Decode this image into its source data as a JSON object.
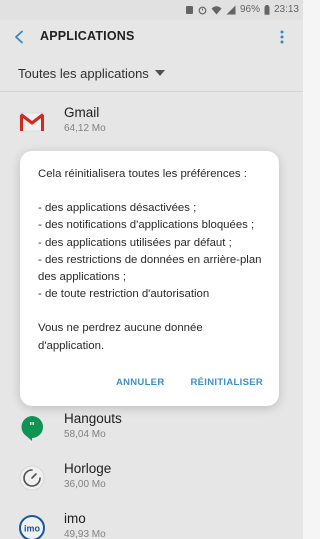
{
  "status_bar": {
    "battery": "96%",
    "time": "23:13"
  },
  "app_bar": {
    "title": "APPLICATIONS"
  },
  "filter": {
    "label": "Toutes les applications"
  },
  "apps": [
    {
      "name": "Gmail",
      "size": "64,12 Mo",
      "icon": "gmail-icon"
    },
    {
      "name": "Hangouts",
      "size": "58,04 Mo",
      "icon": "hangouts-icon"
    },
    {
      "name": "Horloge",
      "size": "36,00 Mo",
      "icon": "clock-icon"
    },
    {
      "name": "imo",
      "size": "49,93 Mo",
      "icon": "imo-icon"
    }
  ],
  "dialog": {
    "intro": "Cela réinitialisera toutes les préférences :",
    "items": [
      "- des applications désactivées ;",
      "- des notifications d'applications bloquées ;",
      "- des applications utilisées par défaut ;",
      "- des restrictions de données en arrière-plan des applications ;",
      "- de toute restriction d'autorisation"
    ],
    "note": "Vous ne perdrez aucune donnée d'application.",
    "cancel_label": "ANNULER",
    "confirm_label": "RÉINITIALISER"
  },
  "colors": {
    "accent": "#3d8fc9",
    "back_arrow": "#3d8fc9",
    "gmail_red": "#d93025",
    "hangouts_green": "#0f9d58",
    "imo_blue": "#1a5ea8"
  }
}
